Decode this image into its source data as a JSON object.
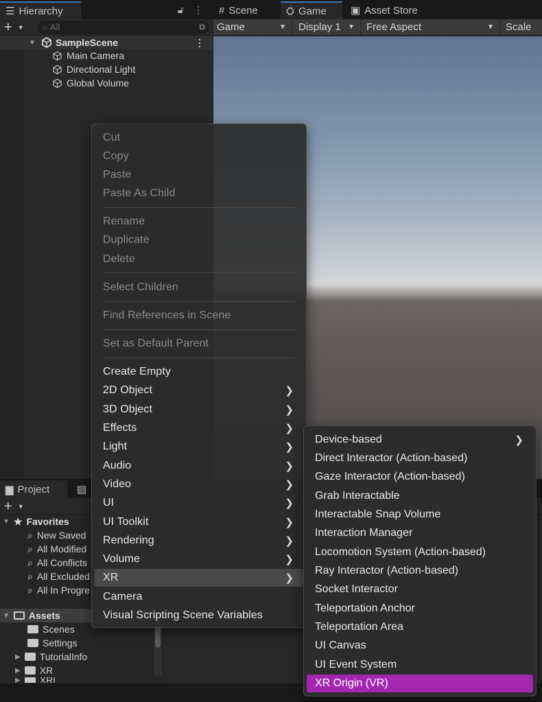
{
  "hierarchy": {
    "tab_label": "Hierarchy",
    "search_placeholder": "All",
    "scene_name": "SampleScene",
    "objects": [
      "Main Camera",
      "Directional Light",
      "Global Volume"
    ]
  },
  "game": {
    "tabs": [
      "Scene",
      "Game",
      "Asset Store"
    ],
    "toolbar": {
      "view": "Game",
      "display": "Display 1",
      "aspect": "Free Aspect",
      "scale_label": "Scale"
    }
  },
  "project": {
    "tab_label": "Project",
    "favorites_label": "Favorites",
    "favorites": [
      "New Saved Search",
      "All Modified",
      "All Conflicts",
      "All Excluded",
      "All In Progress"
    ],
    "assets_label": "Assets",
    "folders": [
      "Scenes",
      "Settings",
      "TutorialInfo",
      "XR",
      "XRI"
    ]
  },
  "context_menu": {
    "groups": [
      [
        "Cut",
        "Copy",
        "Paste",
        "Paste As Child"
      ],
      [
        "Rename",
        "Duplicate",
        "Delete"
      ],
      [
        "Select Children"
      ],
      [
        "Find References in Scene"
      ],
      [
        "Set as Default Parent"
      ]
    ],
    "items": [
      {
        "label": "Create Empty",
        "submenu": false
      },
      {
        "label": "2D Object",
        "submenu": true
      },
      {
        "label": "3D Object",
        "submenu": true
      },
      {
        "label": "Effects",
        "submenu": true
      },
      {
        "label": "Light",
        "submenu": true
      },
      {
        "label": "Audio",
        "submenu": true
      },
      {
        "label": "Video",
        "submenu": true
      },
      {
        "label": "UI",
        "submenu": true
      },
      {
        "label": "UI Toolkit",
        "submenu": true
      },
      {
        "label": "Rendering",
        "submenu": true
      },
      {
        "label": "Volume",
        "submenu": true
      },
      {
        "label": "XR",
        "submenu": true
      },
      {
        "label": "Camera",
        "submenu": false
      },
      {
        "label": "Visual Scripting Scene Variables",
        "submenu": false
      }
    ],
    "highlighted": "XR"
  },
  "xr_submenu": {
    "items": [
      "Device-based",
      "Direct Interactor (Action-based)",
      "Gaze Interactor (Action-based)",
      "Grab Interactable",
      "Interactable Snap Volume",
      "Interaction Manager",
      "Locomotion System (Action-based)",
      "Ray Interactor (Action-based)",
      "Socket Interactor",
      "Teleportation Anchor",
      "Teleportation Area",
      "UI Canvas",
      "UI Event System",
      "XR Origin (VR)"
    ],
    "selected": "XR Origin (VR)",
    "selected_color": "#a427b2"
  }
}
